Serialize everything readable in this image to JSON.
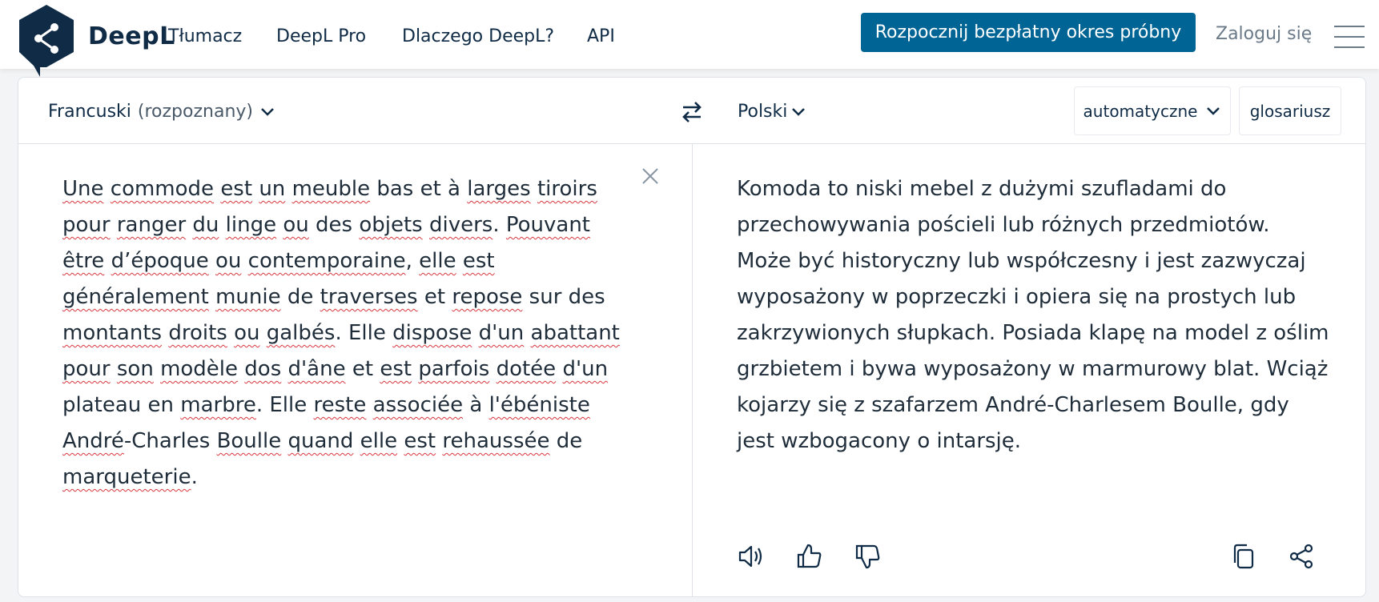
{
  "header": {
    "brand": "DeepL",
    "brand_sub": "Tłumacz",
    "nav": [
      "DeepL Pro",
      "Dlaczego DeepL?",
      "API"
    ],
    "trial_button": "Rozpocznij bezpłatny okres próbny",
    "login": "Zaloguj się",
    "accent_color": "#006494"
  },
  "source": {
    "language": "Francuski",
    "detected_note": "(rozpoznany)",
    "segments": [
      {
        "t": "Une",
        "e": true
      },
      {
        "t": " "
      },
      {
        "t": "commode",
        "e": true
      },
      {
        "t": " "
      },
      {
        "t": "est",
        "e": true
      },
      {
        "t": " "
      },
      {
        "t": "un",
        "e": true
      },
      {
        "t": " "
      },
      {
        "t": "meuble",
        "e": true
      },
      {
        "t": " bas et à "
      },
      {
        "t": "larges",
        "e": true
      },
      {
        "t": " "
      },
      {
        "t": "tiroirs",
        "e": true
      },
      {
        "t": " "
      },
      {
        "t": "pour",
        "e": true
      },
      {
        "t": " "
      },
      {
        "t": "ranger",
        "e": true
      },
      {
        "t": " "
      },
      {
        "t": "du",
        "e": true
      },
      {
        "t": " "
      },
      {
        "t": "linge",
        "e": true
      },
      {
        "t": " "
      },
      {
        "t": "ou",
        "e": true
      },
      {
        "t": " des "
      },
      {
        "t": "objets",
        "e": true
      },
      {
        "t": " "
      },
      {
        "t": "divers",
        "e": true
      },
      {
        "t": ". "
      },
      {
        "t": "Pouvant",
        "e": true
      },
      {
        "t": " "
      },
      {
        "t": "être",
        "e": true
      },
      {
        "t": " "
      },
      {
        "t": "d’époque",
        "e": true
      },
      {
        "t": " "
      },
      {
        "t": "ou",
        "e": true
      },
      {
        "t": " "
      },
      {
        "t": "contemporaine",
        "e": true
      },
      {
        "t": ", "
      },
      {
        "t": "elle",
        "e": true
      },
      {
        "t": " "
      },
      {
        "t": "est",
        "e": true
      },
      {
        "t": " "
      },
      {
        "t": "généralement",
        "e": true
      },
      {
        "t": " "
      },
      {
        "t": "munie",
        "e": true
      },
      {
        "t": " de "
      },
      {
        "t": "traverses",
        "e": true
      },
      {
        "t": " et "
      },
      {
        "t": "repose",
        "e": true
      },
      {
        "t": " sur des "
      },
      {
        "t": "montants",
        "e": true
      },
      {
        "t": " "
      },
      {
        "t": "droits",
        "e": true
      },
      {
        "t": " "
      },
      {
        "t": "ou",
        "e": true
      },
      {
        "t": " "
      },
      {
        "t": "galbés",
        "e": true
      },
      {
        "t": ". Elle "
      },
      {
        "t": "dispose",
        "e": true
      },
      {
        "t": " "
      },
      {
        "t": "d'un",
        "e": true
      },
      {
        "t": " "
      },
      {
        "t": "abattant",
        "e": true
      },
      {
        "t": " "
      },
      {
        "t": "pour",
        "e": true
      },
      {
        "t": " "
      },
      {
        "t": "son",
        "e": true
      },
      {
        "t": " "
      },
      {
        "t": "modèle",
        "e": true
      },
      {
        "t": " "
      },
      {
        "t": "dos",
        "e": true
      },
      {
        "t": " "
      },
      {
        "t": "d'âne",
        "e": true
      },
      {
        "t": " et "
      },
      {
        "t": "est",
        "e": true
      },
      {
        "t": " "
      },
      {
        "t": "parfois",
        "e": true
      },
      {
        "t": " "
      },
      {
        "t": "dotée",
        "e": true
      },
      {
        "t": " "
      },
      {
        "t": "d'un",
        "e": true
      },
      {
        "t": " plateau en "
      },
      {
        "t": "marbre",
        "e": true
      },
      {
        "t": ". Elle "
      },
      {
        "t": "reste",
        "e": true
      },
      {
        "t": " "
      },
      {
        "t": "associée",
        "e": true
      },
      {
        "t": " à "
      },
      {
        "t": "l'ébéniste",
        "e": true
      },
      {
        "t": " "
      },
      {
        "t": "André",
        "e": true
      },
      {
        "t": "-Charles "
      },
      {
        "t": "Boulle",
        "e": true
      },
      {
        "t": " "
      },
      {
        "t": "quand",
        "e": true
      },
      {
        "t": " "
      },
      {
        "t": "elle",
        "e": true
      },
      {
        "t": " "
      },
      {
        "t": "est",
        "e": true
      },
      {
        "t": " "
      },
      {
        "t": "rehaussée",
        "e": true
      },
      {
        "t": " de "
      },
      {
        "t": "marqueterie",
        "e": true
      },
      {
        "t": "."
      }
    ]
  },
  "target": {
    "language": "Polski",
    "formality": "automatyczne",
    "glossary": "glosariusz",
    "text": "Komoda to niski mebel z dużymi szufladami do przechowywania pościeli lub różnych przedmiotów. Może być historyczny lub współczesny i jest zazwyczaj wyposażony w poprzeczki i opiera się na prostych lub zakrzywionych słupkach. Posiada klapę na model z oślim grzbietem i bywa wyposażony w marmurowy blat. Wciąż kojarzy się z szafarzem André-Charlesem Boulle, gdy jest wzbogacony o intarsję."
  },
  "icons": {
    "logo": "deepl-logo-icon",
    "swap": "swap-arrows-icon",
    "clear": "close-icon",
    "speaker": "speaker-icon",
    "thumbs_up": "thumbs-up-icon",
    "thumbs_down": "thumbs-down-icon",
    "copy": "copy-icon",
    "share": "share-icon"
  },
  "colors": {
    "spellcheck": "#d9363e",
    "text": "#0f2b46"
  }
}
